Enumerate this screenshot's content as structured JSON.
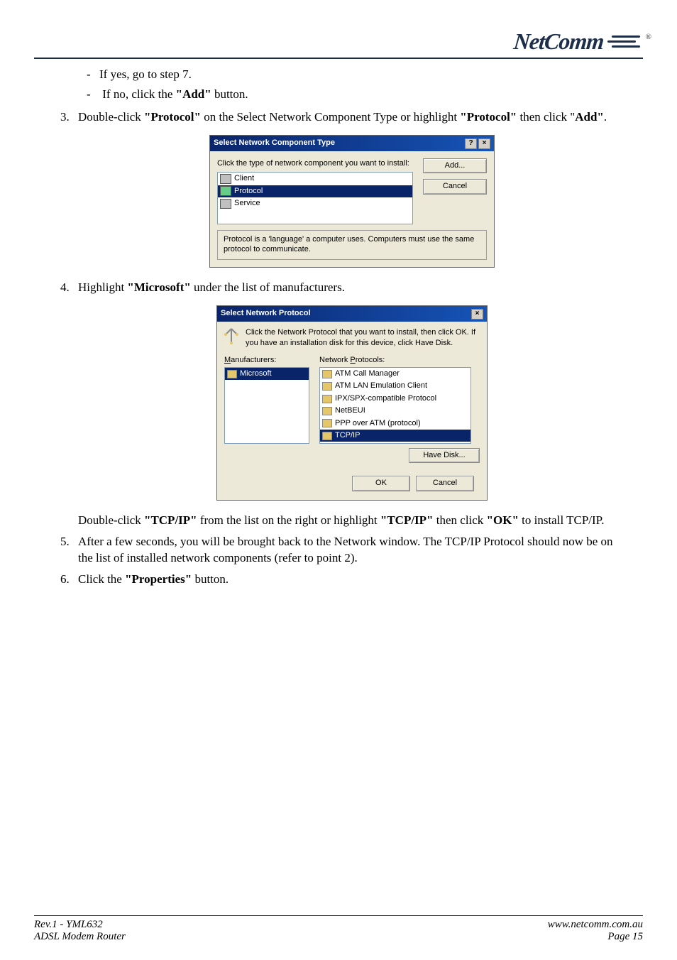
{
  "logo": {
    "text": "NetComm",
    "reg": "®"
  },
  "body": {
    "dash1": "If yes, go to step 7.",
    "dash2_pre": "If no, click the ",
    "dash2_bold": "\"Add\"",
    "dash2_post": " button.",
    "step3_pre": "Double-click ",
    "step3_b1": "\"Protocol\"",
    "step3_mid": " on the Select Network Component Type or highlight ",
    "step3_b2": "\"Protocol\"",
    "step3_mid2": " then click \"",
    "step3_b3": "Add\"",
    "step3_post": ".",
    "step4_pre": "Highlight ",
    "step4_b1": "\"Microsoft\"",
    "step4_post": " under the list of manufacturers.",
    "step4b_pre": "Double-click ",
    "step4b_b1": "\"TCP/IP\"",
    "step4b_mid": " from the list on the right or highlight ",
    "step4b_b2": "\"TCP/IP\"",
    "step4b_mid2": " then click ",
    "step4b_b3": "\"OK\"",
    "step4b_post": " to install TCP/IP.",
    "step5": "After a few seconds, you will be brought back to the Network window. The TCP/IP Protocol should now be on the list of installed network components (refer to point 2).",
    "step6_pre": "Click the ",
    "step6_b1": "\"Properties\"",
    "step6_post": " button."
  },
  "dlg1": {
    "title": "Select Network Component Type",
    "prompt": "Click the type of network component you want to install:",
    "items": [
      "Client",
      "Protocol",
      "Service"
    ],
    "add": "Add...",
    "cancel": "Cancel",
    "desc": "Protocol is a 'language' a computer uses. Computers must use the same protocol to communicate."
  },
  "dlg2": {
    "title": "Select Network Protocol",
    "prompt": "Click the Network Protocol that you want to install, then click OK. If you have an installation disk for this device, click Have Disk.",
    "mfg_label": "Manufacturers:",
    "proto_label": "Network Protocols:",
    "mfg": [
      "Microsoft"
    ],
    "protocols": [
      "ATM Call Manager",
      "ATM LAN Emulation Client",
      "IPX/SPX-compatible Protocol",
      "NetBEUI",
      "PPP over ATM (protocol)",
      "TCP/IP"
    ],
    "have_disk": "Have Disk...",
    "ok": "OK",
    "cancel": "Cancel"
  },
  "footer": {
    "l1": "Rev.1 - YML632",
    "l2": "ADSL Modem Router",
    "r1": "www.netcomm.com.au",
    "r2": "Page 15"
  }
}
